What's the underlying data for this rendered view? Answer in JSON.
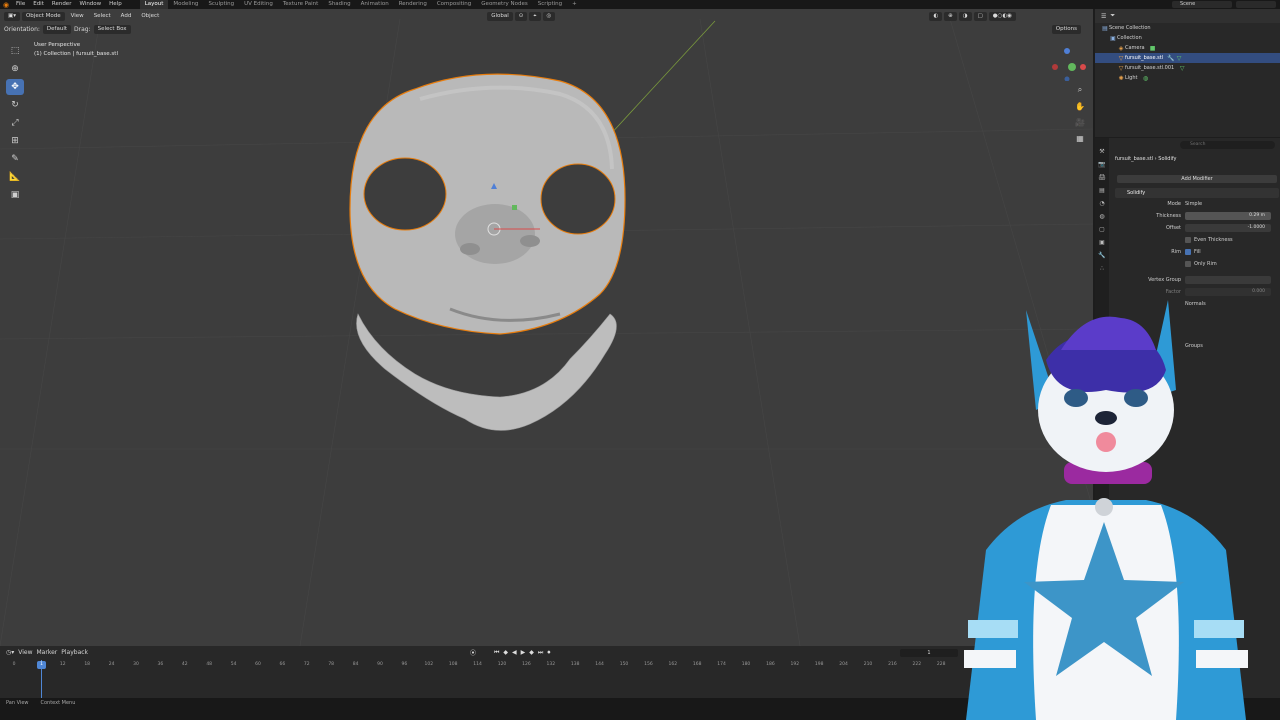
{
  "menu": [
    "File",
    "Edit",
    "Render",
    "Window",
    "Help"
  ],
  "workspaces": [
    "Layout",
    "Modeling",
    "Sculpting",
    "UV Editing",
    "Texture Paint",
    "Shading",
    "Animation",
    "Rendering",
    "Compositing",
    "Geometry Nodes",
    "Scripting"
  ],
  "active_workspace": "Layout",
  "scene_name": "Scene",
  "viewport": {
    "mode": "Object Mode",
    "menus": [
      "View",
      "Select",
      "Add",
      "Object"
    ],
    "transform": "Global",
    "orientation_label": "Orientation:",
    "orientation_value": "Default",
    "drag_label": "Drag:",
    "drag_value": "Select Box",
    "options": "Options",
    "perspective": "User Perspective",
    "collection_info": "(1) Collection | fursuit_base.stl"
  },
  "outliner": {
    "search_placeholder": "",
    "rows": [
      {
        "name": "Scene Collection",
        "icon": "scene-collection-icon",
        "indent": 0
      },
      {
        "name": "Collection",
        "icon": "collection-icon",
        "indent": 1
      },
      {
        "name": "Camera",
        "icon": "camera-icon",
        "indent": 2
      },
      {
        "name": "fursuit_base.stl",
        "icon": "mesh-icon",
        "indent": 2,
        "selected": true
      },
      {
        "name": "fursuit_base.stl.001",
        "icon": "mesh-icon",
        "indent": 2
      },
      {
        "name": "Light",
        "icon": "light-icon",
        "indent": 2
      }
    ]
  },
  "properties": {
    "search_placeholder": "Search",
    "breadcrumb_object": "fursuit_base.stl",
    "breadcrumb_modifier": "Solidify",
    "add_modifier": "Add Modifier",
    "modifier_name": "Solidify",
    "mode_label": "Mode",
    "mode_value": "Simple",
    "thickness_label": "Thickness",
    "thickness_value": "0.29 m",
    "offset_label": "Offset",
    "offset_value": "-1.0000",
    "even_thickness": "Even Thickness",
    "rim_label": "Rim",
    "fill_label": "Fill",
    "only_rim": "Only Rim",
    "vertex_group_label": "Vertex Group",
    "factor_label": "Factor",
    "factor_value": "0.000",
    "normals_label": "Normals",
    "groups_label": "Groups"
  },
  "timeline": {
    "menus": [
      "View",
      "Marker",
      "Playback"
    ],
    "current_frame": "1",
    "ticks": [
      "0",
      "6",
      "12",
      "18",
      "24",
      "30",
      "36",
      "42",
      "48",
      "54",
      "60",
      "66",
      "72",
      "78",
      "84",
      "90",
      "96",
      "102",
      "108",
      "114",
      "120",
      "126",
      "132",
      "138",
      "144",
      "150",
      "156",
      "162",
      "168",
      "174",
      "180",
      "186",
      "192",
      "198",
      "204",
      "210",
      "216",
      "222",
      "228"
    ]
  },
  "status": {
    "left": "Pan View",
    "context": "Context Menu"
  },
  "colors": {
    "accent": "#4772b3",
    "selection": "#e87d0d",
    "viewport_bg": "#3d3d3d"
  }
}
